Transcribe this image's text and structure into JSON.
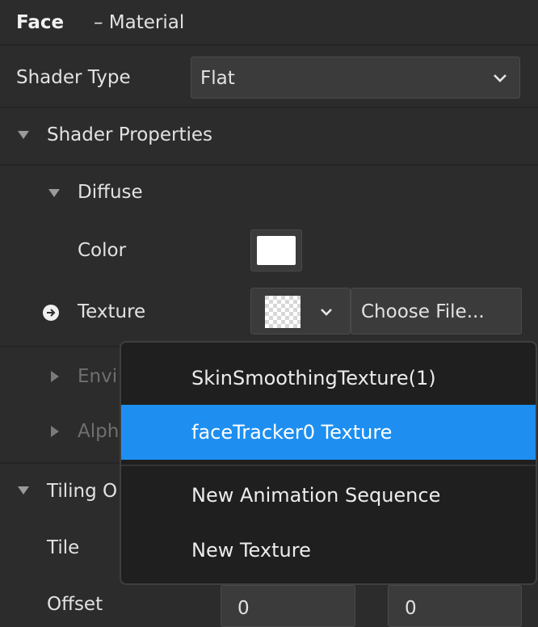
{
  "header": {
    "object_name": "Face",
    "section_label": "– Material"
  },
  "shader_type": {
    "label": "Shader Type",
    "value": "Flat"
  },
  "shader_properties": {
    "label": "Shader Properties"
  },
  "diffuse": {
    "label": "Diffuse",
    "color": {
      "label": "Color",
      "value": "#ffffff"
    },
    "texture": {
      "label": "Texture",
      "choose_file_label": "Choose File..."
    }
  },
  "environment": {
    "label_partial": "Envi"
  },
  "alpha": {
    "label_partial": "Alph"
  },
  "tiling": {
    "label_partial": "Tiling O",
    "tile_label": "Tile",
    "offset_label": "Offset",
    "offset_x": "0",
    "offset_y": "0"
  },
  "dropdown": {
    "items": [
      {
        "label": "SkinSmoothingTexture(1)",
        "selected": false
      },
      {
        "label": "faceTracker0 Texture",
        "selected": true
      },
      {
        "label": "New Animation Sequence",
        "selected": false
      },
      {
        "label": "New Texture",
        "selected": false
      }
    ]
  },
  "colors": {
    "accent": "#1e8ff0",
    "background": "#2c2c2c",
    "menu_background": "#1f1f1f"
  }
}
